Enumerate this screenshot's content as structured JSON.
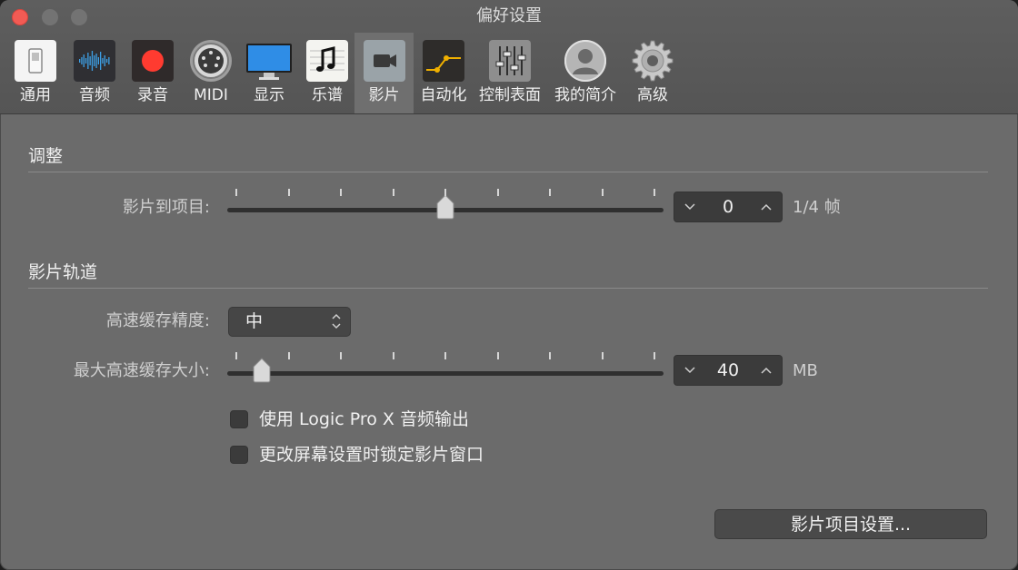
{
  "window": {
    "title": "偏好设置"
  },
  "toolbar": {
    "tabs": [
      {
        "label": "通用",
        "icon": "switch-icon"
      },
      {
        "label": "音频",
        "icon": "waveform-icon"
      },
      {
        "label": "录音",
        "icon": "record-icon"
      },
      {
        "label": "MIDI",
        "icon": "midi-port-icon"
      },
      {
        "label": "显示",
        "icon": "display-icon"
      },
      {
        "label": "乐谱",
        "icon": "music-note-icon"
      },
      {
        "label": "影片",
        "icon": "video-camera-icon",
        "selected": true
      },
      {
        "label": "自动化",
        "icon": "automation-curve-icon"
      },
      {
        "label": "控制表面",
        "icon": "faders-icon"
      },
      {
        "label": "我的简介",
        "icon": "user-silhouette-icon"
      },
      {
        "label": "高级",
        "icon": "gear-icon"
      }
    ]
  },
  "adjust": {
    "header": "调整",
    "offset_label": "影片到项目:",
    "offset_value": "0",
    "offset_unit": "1/4 帧",
    "offset_slider_fraction": 0.5
  },
  "track": {
    "header": "影片轨道",
    "cache_quality_label": "高速缓存精度:",
    "cache_quality_value": "中",
    "cache_size_label": "最大高速缓存大小:",
    "cache_size_value": "40",
    "cache_size_unit": "MB",
    "cache_size_slider_fraction": 0.06,
    "checkbox_logic_audio": {
      "label": "使用 Logic Pro X 音频输出",
      "checked": false
    },
    "checkbox_lock_window": {
      "label": "更改屏幕设置时锁定影片窗口",
      "checked": false
    }
  },
  "footer": {
    "project_settings_button": "影片项目设置..."
  },
  "colors": {
    "accent_record": "#ff3b30",
    "waveform": "#3da0e6",
    "automation": "#f0b000"
  }
}
